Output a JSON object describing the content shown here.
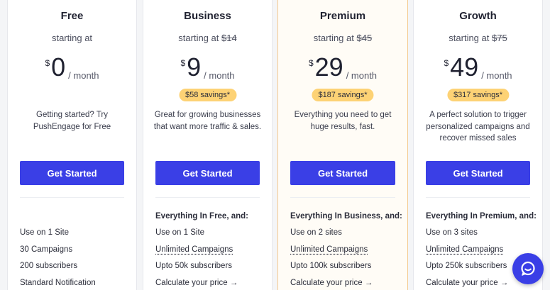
{
  "plans": [
    {
      "name": "Free",
      "starting_text": "starting at",
      "old_price": "",
      "currency": "$",
      "amount": "0",
      "period": "/ month",
      "savings": "",
      "description": "Getting started? Try PushEngage for Free",
      "cta": "Get Started",
      "features_heading": "",
      "features": [
        "Use on 1 Site",
        "30 Campaigns",
        "200 subscribers",
        "Standard Notification"
      ]
    },
    {
      "name": "Business",
      "starting_text": "starting at",
      "old_price": "$14",
      "currency": "$",
      "amount": "9",
      "period": "/ month",
      "savings": "$58 savings*",
      "description": "Great for growing businesses that want more traffic & sales.",
      "cta": "Get Started",
      "features_heading": "Everything In Free, and:",
      "features": [
        "Use on 1 Site",
        "Unlimited Campaigns",
        "Upto 50k subscribers",
        "Calculate your price →"
      ]
    },
    {
      "name": "Premium",
      "starting_text": "starting at",
      "old_price": "$45",
      "currency": "$",
      "amount": "29",
      "period": "/ month",
      "savings": "$187 savings*",
      "description": "Everything you need to get huge results, fast.",
      "cta": "Get Started",
      "features_heading": "Everything In Business, and:",
      "features": [
        "Use on 2 sites",
        "Unlimited Campaigns",
        "Upto 100k subscribers",
        "Calculate your price →"
      ]
    },
    {
      "name": "Growth",
      "starting_text": "starting at",
      "old_price": "$75",
      "currency": "$",
      "amount": "49",
      "period": "/ month",
      "savings": "$317 savings*",
      "description": "A perfect solution to trigger personalized campaigns and recover missed sales",
      "cta": "Get Started",
      "features_heading": "Everything In Premium, and:",
      "features": [
        "Use on 3 sites",
        "Unlimited Campaigns",
        "Upto 250k subscribers",
        "Calculate your price →"
      ]
    }
  ],
  "chat": {
    "icon": "chat-bubble-icon"
  },
  "colors": {
    "accent": "#3a3fe6",
    "savings_badge": "#fdd275",
    "featured_bg": "#fffcf6"
  }
}
